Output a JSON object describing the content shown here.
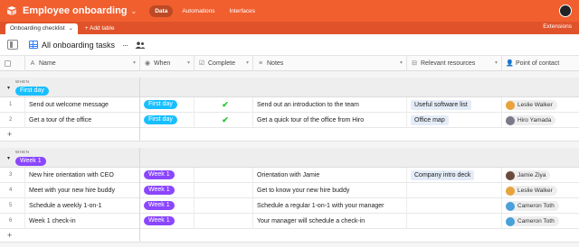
{
  "app": {
    "title": "Employee onboarding",
    "brand_color": "#f15f2f"
  },
  "topnav": [
    {
      "label": "Data",
      "active": true
    },
    {
      "label": "Automations",
      "active": false
    },
    {
      "label": "Interfaces",
      "active": false
    }
  ],
  "tabs": {
    "active": "Onboarding checklist",
    "add_label": "+ Add table",
    "extensions": "Extensions"
  },
  "view": {
    "name": "All onboarding tasks",
    "more": "···"
  },
  "columns": {
    "name": "Name",
    "when": "When",
    "complete": "Complete",
    "notes": "Notes",
    "resources": "Relevant resources",
    "contact": "Point of contact"
  },
  "groups": [
    {
      "label": "WHEN",
      "value": "First day",
      "color": "#18bfff",
      "rows": [
        {
          "num": "1",
          "name": "Send out welcome message",
          "when": "First day",
          "complete": true,
          "notes": "Send out an introduction to the team",
          "resource": "Useful software list",
          "contact": "Leslie Walker"
        },
        {
          "num": "2",
          "name": "Get a tour of the office",
          "when": "First day",
          "complete": true,
          "notes": "Get a quick tour of the office from Hiro",
          "resource": "Office map",
          "contact": "Hiro Yamada"
        }
      ],
      "add": "+"
    },
    {
      "label": "WHEN",
      "value": "Week 1",
      "color": "#8b46ff",
      "rows": [
        {
          "num": "3",
          "name": "New hire orientation with CEO",
          "when": "Week 1",
          "complete": false,
          "notes": "Orientation with Jamie",
          "resource": "Company intro deck",
          "contact": "Jamie Ziya"
        },
        {
          "num": "4",
          "name": "Meet with your new hire buddy",
          "when": "Week 1",
          "complete": false,
          "notes": "Get to know your new hire buddy",
          "resource": "",
          "contact": "Leslie Walker"
        },
        {
          "num": "5",
          "name": "Schedule a weekly 1-on-1",
          "when": "Week 1",
          "complete": false,
          "notes": "Schedule a regular 1-on-1 with your manager",
          "resource": "",
          "contact": "Cameron Toth"
        },
        {
          "num": "6",
          "name": "Week 1 check-in",
          "when": "Week 1",
          "complete": false,
          "notes": "Your manager will schedule a check-in",
          "resource": "",
          "contact": "Cameron Toth"
        }
      ],
      "add": "+"
    }
  ],
  "icons": {
    "when": "circle-down-icon",
    "complete": "checkbox-icon",
    "notes": "long-text-icon",
    "resources": "link-icon",
    "contact": "person-icon"
  }
}
